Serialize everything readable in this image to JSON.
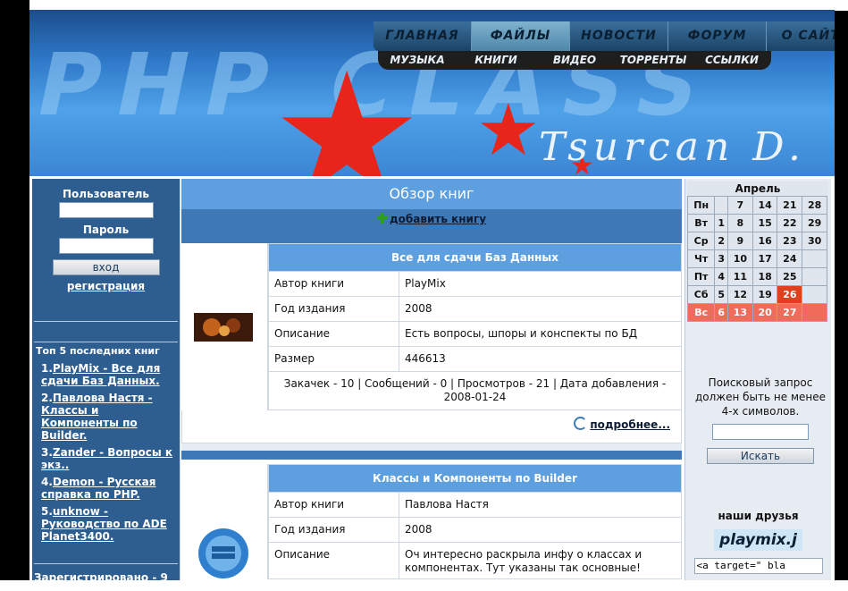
{
  "nav": {
    "main": [
      "ГЛАВНАЯ",
      "ФАЙЛЫ",
      "НОВОСТИ",
      "ФОРУМ",
      "О САЙТЕ"
    ],
    "active_index": 1,
    "sub": [
      "МУЗЫКА",
      "КНИГИ",
      "ВИДЕО",
      "ТОРРЕНТЫ",
      "ССЫЛКИ"
    ]
  },
  "header": {
    "logo_text": "PHP CLASS",
    "signature": "Tsurcan D."
  },
  "login": {
    "user_label": "Пользователь",
    "password_label": "Пароль",
    "login_button": "вход",
    "register_link": "регистрация"
  },
  "top5": {
    "title": "Топ 5 последних книг",
    "items": [
      {
        "num": "1.",
        "text": "PlayMix - Все для сдачи Баз Данных."
      },
      {
        "num": "2.",
        "text": "Павлова Настя - Классы и Компоненты по Builder."
      },
      {
        "num": "3.",
        "text": "Zander - Вопросы к экз.."
      },
      {
        "num": "4.",
        "text": "Demon - Русская справка по PHP."
      },
      {
        "num": "5.",
        "text": "unknow - Руководство по ADE Planet3400."
      }
    ]
  },
  "registered": {
    "label": "Зарегистрировано -",
    "count": "9"
  },
  "main": {
    "title": "Обзор книг",
    "add_link": "добавить книгу",
    "books": [
      {
        "title": "Все для сдачи Баз Данных",
        "rows": [
          {
            "k": "Автор книги",
            "v": "PlayMix"
          },
          {
            "k": "Год издания",
            "v": "2008"
          },
          {
            "k": "Описание",
            "v": "Есть вопросы, шпоры и конспекты по БД"
          },
          {
            "k": "Размер",
            "v": "446613"
          }
        ],
        "stats": "Закачек - 10 | Сообщений - 0 | Просмотров - 21 | Дата добавления - 2008-01-24",
        "more": "подробнее..."
      },
      {
        "title": "Классы и Компоненты по Builder",
        "rows": [
          {
            "k": "Автор книги",
            "v": "Павлова Настя"
          },
          {
            "k": "Год издания",
            "v": "2008"
          },
          {
            "k": "Описание",
            "v": "Оч интересно раскрыла инфу о классах и компонентах. Тут указаны так основные!"
          }
        ]
      }
    ]
  },
  "calendar": {
    "month": "Апрель",
    "rows": [
      {
        "day": "Пн",
        "cells": [
          "",
          "7",
          "14",
          "21",
          "28"
        ]
      },
      {
        "day": "Вт",
        "cells": [
          "1",
          "8",
          "15",
          "22",
          "29"
        ]
      },
      {
        "day": "Ср",
        "cells": [
          "2",
          "9",
          "16",
          "23",
          "30"
        ]
      },
      {
        "day": "Чт",
        "cells": [
          "3",
          "10",
          "17",
          "24",
          ""
        ]
      },
      {
        "day": "Пт",
        "cells": [
          "4",
          "11",
          "18",
          "25",
          ""
        ]
      },
      {
        "day": "Сб",
        "cells": [
          "5",
          "12",
          "19",
          "26",
          ""
        ]
      },
      {
        "day": "Вс",
        "cells": [
          "6",
          "13",
          "20",
          "27",
          ""
        ]
      }
    ],
    "today": "26"
  },
  "search": {
    "message": "Поисковый запрос должен быть не менее 4-х символов.",
    "button": "Искать"
  },
  "friends": {
    "title": "наши друзья",
    "logo": "playmix.j",
    "code": "<a target=\" bla"
  },
  "colors": {
    "accent": "#5e9fe0",
    "dark_blue": "#2e5d8f",
    "today": "#e1401e",
    "sunday": "#f06b5a"
  }
}
